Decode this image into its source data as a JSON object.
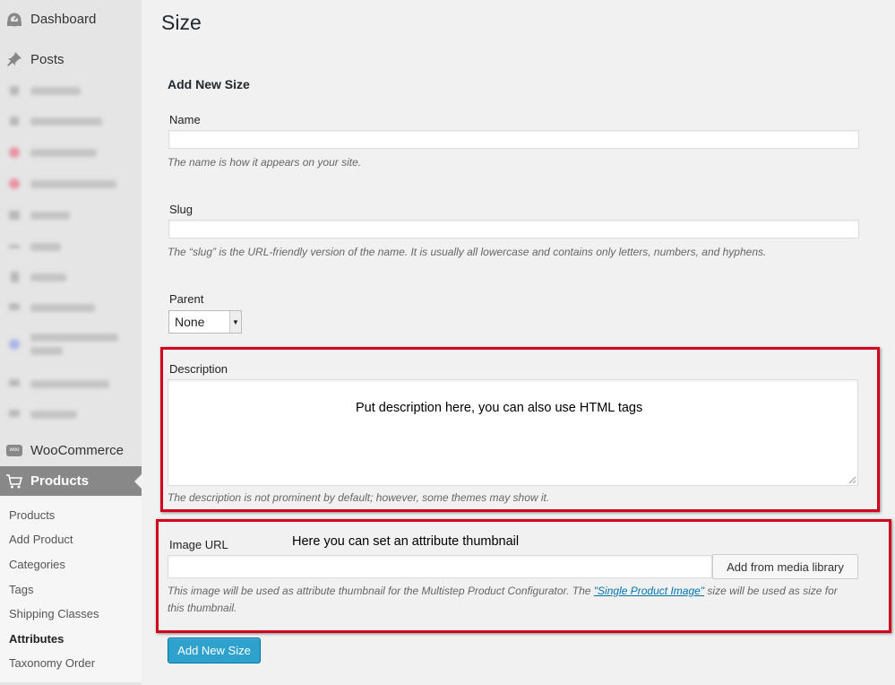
{
  "sidebar": {
    "dashboard_label": "Dashboard",
    "posts_label": "Posts",
    "woocommerce_label": "WooCommerce",
    "woocommerce_icon_text": "woo",
    "products_label": "Products",
    "submenu": [
      "Products",
      "Add Product",
      "Categories",
      "Tags",
      "Shipping Classes",
      "Attributes",
      "Taxonomy Order"
    ],
    "current_submenu": "Attributes"
  },
  "page": {
    "title": "Size",
    "form_heading": "Add New Size"
  },
  "form": {
    "name": {
      "label": "Name",
      "value": "",
      "help": "The name is how it appears on your site."
    },
    "slug": {
      "label": "Slug",
      "value": "",
      "help": "The “slug” is the URL-friendly version of the name. It is usually all lowercase and contains only letters, numbers, and hyphens."
    },
    "parent": {
      "label": "Parent",
      "selected": "None"
    },
    "description": {
      "label": "Description",
      "value": "",
      "help": "The description is not prominent by default; however, some themes may show it."
    },
    "image_url": {
      "label": "Image URL",
      "value": "",
      "button_label": "Add from media library",
      "help_before": "This image will be used as attribute thumbnail for the Multistep Product Configurator. The ",
      "help_link": "\"Single Product Image\"",
      "help_after_line1": " size will be used as size for",
      "help_line2": "this thumbnail."
    },
    "submit_label": "Add New Size"
  },
  "annotations": {
    "description_note": "Put description here, you can also use HTML tags",
    "image_note": "Here you can set an attribute thumbnail",
    "highlight_color": "#d0021b"
  },
  "colors": {
    "primary_button": "#2ea2cc",
    "link": "#0073aa",
    "sidebar_active": "#888888"
  }
}
